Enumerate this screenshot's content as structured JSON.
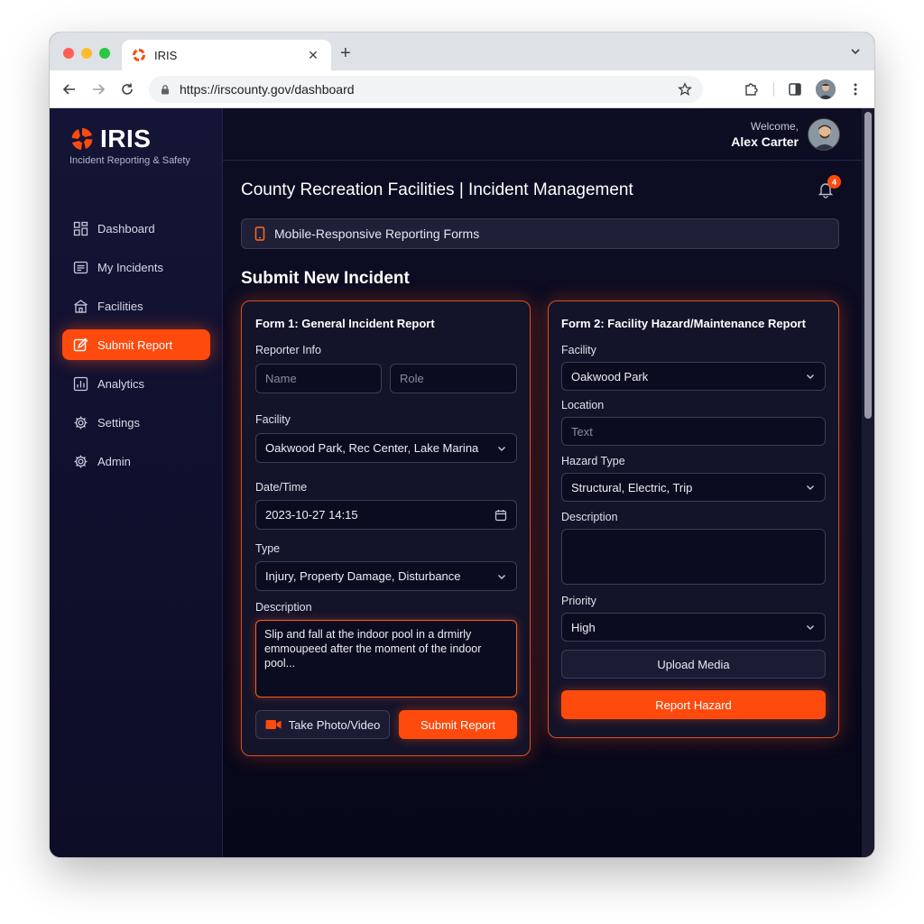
{
  "browser": {
    "tab_title": "IRIS",
    "new_tab": "+",
    "url": "https://irscounty.gov/dashboard"
  },
  "brand": {
    "name": "IRIS",
    "tagline": "Incident Reporting & Safety",
    "accent": "#ff4a0e"
  },
  "sidebar": {
    "items": [
      {
        "label": "Dashboard",
        "icon": "grid-icon"
      },
      {
        "label": "My Incidents",
        "icon": "list-icon"
      },
      {
        "label": "Facilities",
        "icon": "building-icon"
      },
      {
        "label": "Submit Report",
        "icon": "edit-icon",
        "active": true
      },
      {
        "label": "Analytics",
        "icon": "chart-icon"
      },
      {
        "label": "Settings",
        "icon": "gear-icon"
      },
      {
        "label": "Admin",
        "icon": "gear-icon"
      }
    ]
  },
  "header": {
    "welcome_label": "Welcome,",
    "user_name": "Alex Carter",
    "page_title": "County Recreation Facilities | Incident Management",
    "notification_count": "4"
  },
  "banner": {
    "text": "Mobile-Responsive Reporting Forms"
  },
  "main": {
    "section_title": "Submit New Incident"
  },
  "form1": {
    "title": "Form 1: General Incident Report",
    "reporter_label": "Reporter Info",
    "name_placeholder": "Name",
    "role_placeholder": "Role",
    "facility_label": "Facility",
    "facility_value": "Oakwood Park,  Rec Center,  Lake Marina",
    "datetime_label": "Date/Time",
    "datetime_value": "2023-10-27 14:15",
    "type_label": "Type",
    "type_value": "Injury,  Property Damage,  Disturbance",
    "description_label": "Description",
    "description_value": "Slip and fall at the indoor pool in a drmirly emmoupeed after the moment of the indoor pool...",
    "photo_button": "Take Photo/Video",
    "submit_button": "Submit Report"
  },
  "form2": {
    "title": "Form 2: Facility Hazard/Maintenance Report",
    "facility_label": "Facility",
    "facility_value": "Oakwood Park",
    "location_label": "Location",
    "location_placeholder": "Text",
    "hazard_label": "Hazard Type",
    "hazard_value": "Structural,  Electric,  Trip",
    "description_label": "Description",
    "description_value": "",
    "priority_label": "Priority",
    "priority_value": "High",
    "upload_button": "Upload Media",
    "report_button": "Report Hazard"
  }
}
